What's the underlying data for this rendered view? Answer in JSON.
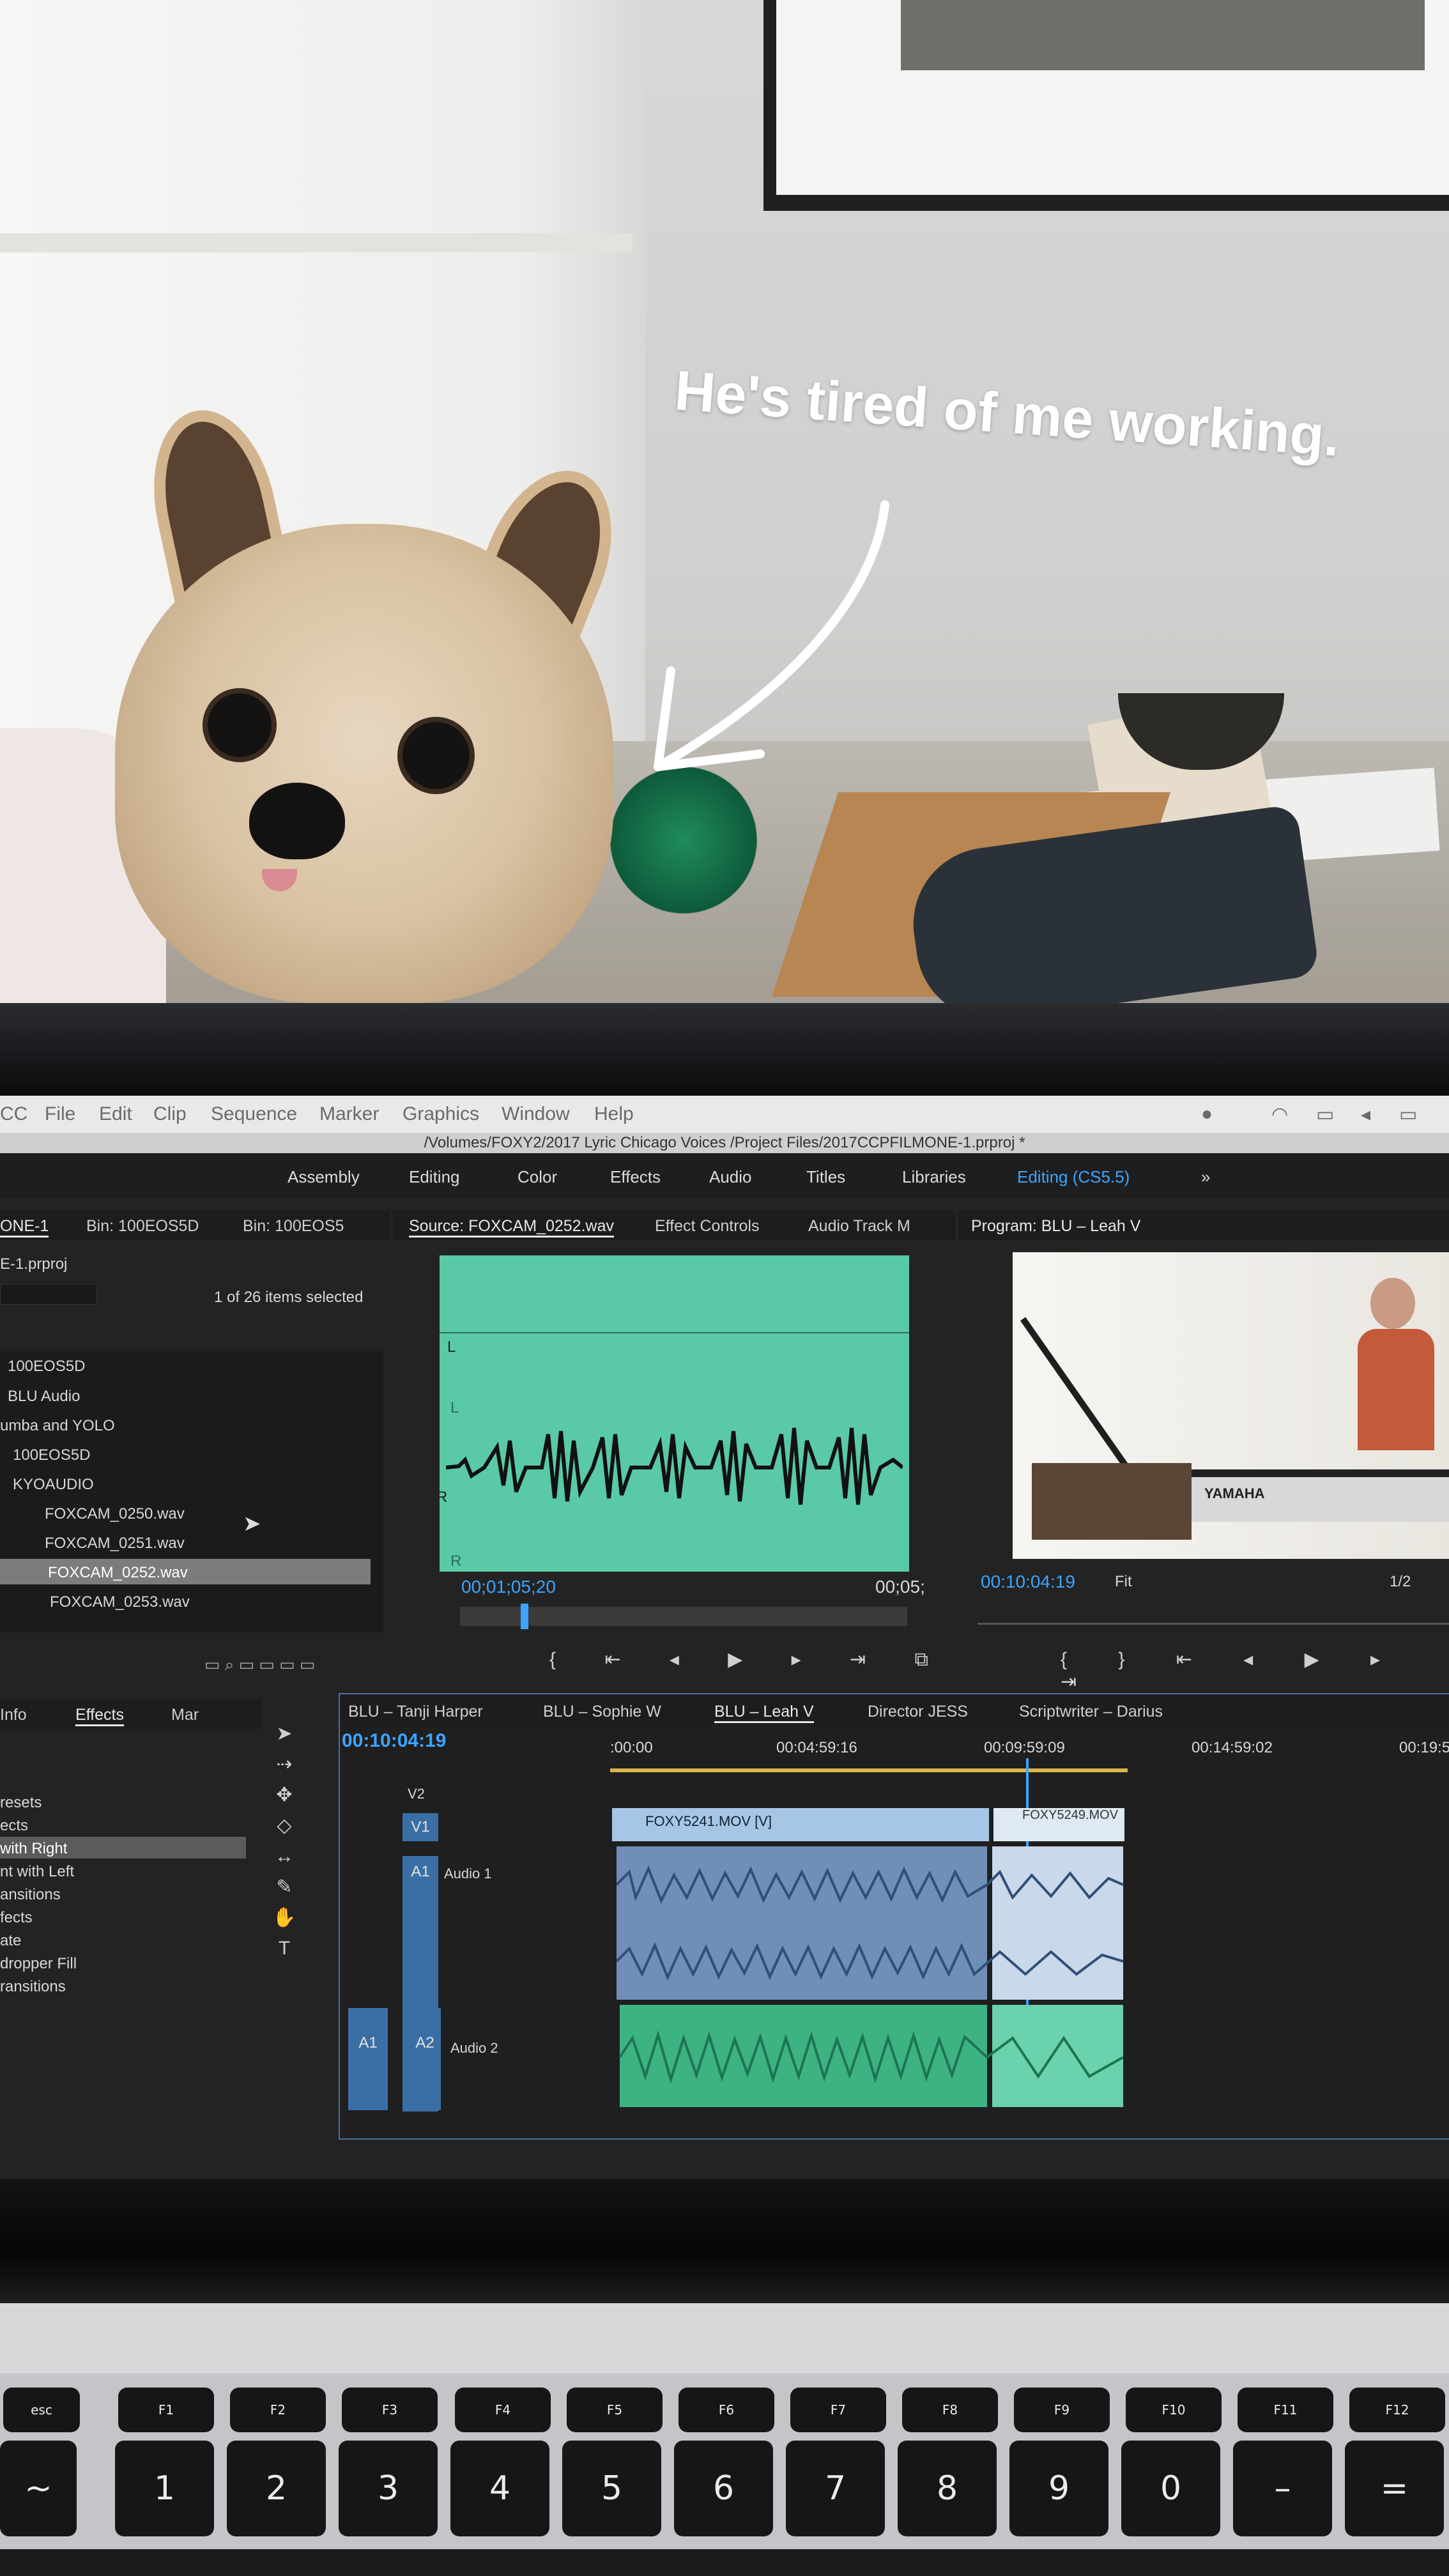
{
  "caption": "He's tired of me working.",
  "menubar": {
    "items": [
      "CC",
      "File",
      "Edit",
      "Clip",
      "Sequence",
      "Marker",
      "Graphics",
      "Window",
      "Help"
    ]
  },
  "path": "/Volumes/FOXY2/2017 Lyric Chicago Voices /Project Files/2017CCPFILMONE-1.prproj *",
  "workspaces": [
    "Assembly",
    "Editing",
    "Color",
    "Effects",
    "Audio",
    "Titles",
    "Libraries",
    "Editing (CS5.5)",
    "»"
  ],
  "project_panel": {
    "tabs": [
      "ONE-1",
      "Bin: 100EOS5D",
      "Bin: 100EOS5"
    ],
    "project_file": "E-1.prproj",
    "selection_status": "1 of 26 items selected",
    "items": [
      "100EOS5D",
      "BLU Audio",
      "umba and YOLO",
      "100EOS5D",
      "KYOAUDIO",
      "FOXCAM_0250.wav",
      "FOXCAM_0251.wav",
      "FOXCAM_0252.wav",
      "FOXCAM_0253.wav"
    ],
    "selected_item": "FOXCAM_0252.wav"
  },
  "source_panel": {
    "tabs": [
      "Source: FOXCAM_0252.wav",
      "Effect Controls",
      "Audio Track M"
    ],
    "timecode": "00;01;05;20",
    "duration": "00;05;",
    "channel_labels": [
      "L",
      "L",
      "R",
      "R"
    ]
  },
  "program_panel": {
    "tab": "Program: BLU – Leah V",
    "timecode": "00:10:04:19",
    "zoom": "Fit",
    "resolution": "1/2",
    "brand_text": "YAMAHA"
  },
  "effects_panel": {
    "tabs": [
      "Info",
      "Effects",
      "Mar"
    ],
    "items": [
      "resets",
      "ects",
      "with Right",
      "nt with Left",
      "ansitions",
      "fects",
      "ate",
      "dropper Fill",
      "ransitions"
    ],
    "selected_item": "with Right"
  },
  "timeline": {
    "tabs": [
      "BLU – Tanji Harper",
      "BLU – Sophie W",
      "BLU – Leah V",
      "Director JESS",
      "Scriptwriter – Darius"
    ],
    "active_tab": "BLU – Leah V",
    "timecode": "00:10:04:19",
    "ruler": [
      ":00:00",
      "00:04:59:16",
      "00:09:59:09",
      "00:14:59:02",
      "00:19:5"
    ],
    "tracks": [
      "V2",
      "V1",
      "A1",
      "A1",
      "A2"
    ],
    "track_names": [
      "Audio 1",
      "Audio 2"
    ],
    "clips": [
      "FOXY5241.MOV [V]",
      "FOXY5249.MOV"
    ]
  },
  "keyboard": {
    "fkeys": [
      "esc",
      "F1",
      "F2",
      "F3",
      "F4",
      "F5",
      "F6",
      "F7",
      "F8",
      "F9",
      "F10",
      "F11",
      "F12"
    ],
    "numkeys": [
      "~",
      "!",
      "@",
      "#",
      "$",
      "%",
      "^",
      "&",
      "*",
      "(",
      ")",
      "–",
      "+"
    ],
    "numkeys_lower": [
      "`",
      "1",
      "2",
      "3",
      "4",
      "5",
      "6",
      "7",
      "8",
      "9",
      "0",
      "–",
      "="
    ]
  },
  "colors": {
    "waveform_bg": "#59c9a8",
    "timeline_blue": "#3a6fa5",
    "accent_blue": "#3da4ff"
  }
}
